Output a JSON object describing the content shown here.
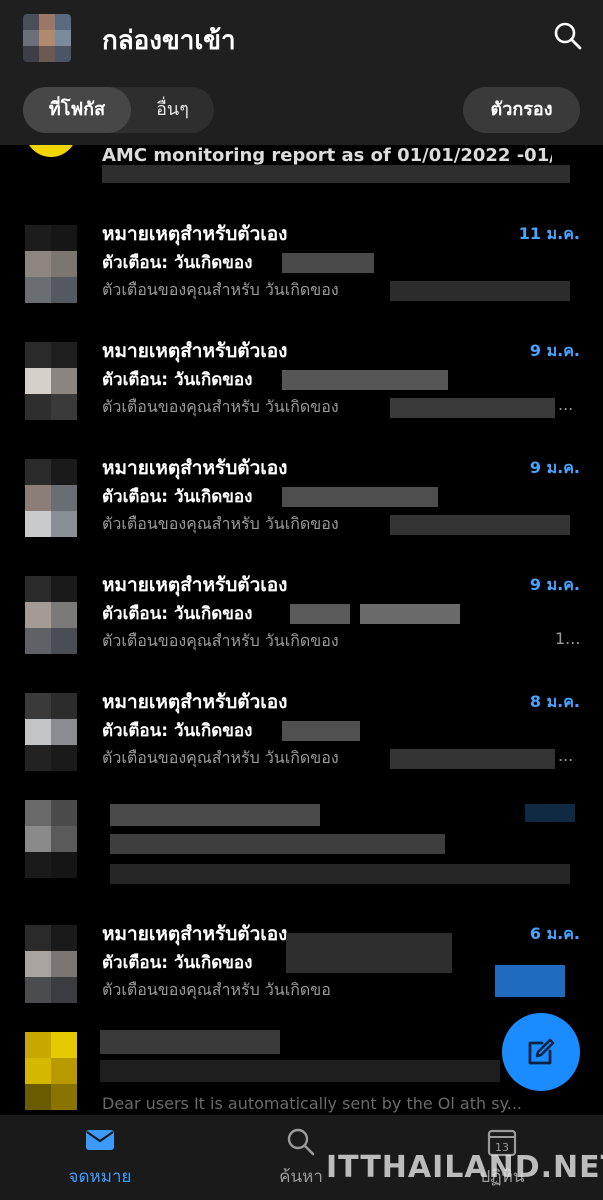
{
  "header": {
    "title": "กล่องขาเข้า",
    "tabs": [
      {
        "label": "ที่โฟกัส",
        "selected": true
      },
      {
        "label": "อื่นๆ",
        "selected": false
      }
    ],
    "filter_label": "ตัวกรอง",
    "search_icon": "search-icon"
  },
  "list": {
    "partial_subject": "AMC monitoring report as of 01/01/2022 -01/1...",
    "messages": [
      {
        "subject": "หมายเหตุสำหรับตัวเอง",
        "date": "11 ม.ค.",
        "sender": "ตัวเตือน: วันเกิดของ",
        "preview": "ตัวเตือนของคุณสำหรับ วันเกิดของ"
      },
      {
        "subject": "หมายเหตุสำหรับตัวเอง",
        "date": "9 ม.ค.",
        "sender": "ตัวเตือน: วันเกิดของ",
        "preview": "ตัวเตือนของคุณสำหรับ วันเกิดของ",
        "tail": "..."
      },
      {
        "subject": "หมายเหตุสำหรับตัวเอง",
        "date": "9 ม.ค.",
        "sender": "ตัวเตือน: วันเกิดของ",
        "preview": "ตัวเตือนของคุณสำหรับ วันเกิดของ"
      },
      {
        "subject": "หมายเหตุสำหรับตัวเอง",
        "date": "9 ม.ค.",
        "sender": "ตัวเตือน: วันเกิดของ",
        "preview": "ตัวเตือนของคุณสำหรับ วันเกิดของ",
        "tail": "1..."
      },
      {
        "subject": "หมายเหตุสำหรับตัวเอง",
        "date": "8 ม.ค.",
        "sender": "ตัวเตือน: วันเกิดของ",
        "preview": "ตัวเตือนของคุณสำหรับ วันเกิดของ",
        "tail": "..."
      },
      {
        "subject": "หมายเหตุสำหรับตัวเอง",
        "date": "6 ม.ค.",
        "sender": "ตัวเตือน: วันเกิดของ",
        "preview": "ตัวเตือนของคุณสำหรับ วันเกิดขอ"
      }
    ],
    "last_preview": "Dear users It is automatically sent by the Ol ath sy..."
  },
  "bottom_nav": {
    "items": [
      {
        "label": "จดหมาย",
        "icon": "mail-icon",
        "active": true
      },
      {
        "label": "ค้นหา",
        "icon": "search-icon",
        "active": false
      },
      {
        "label": "ปฏิทิน",
        "icon": "calendar-icon",
        "active": false,
        "calendar_day": "13"
      }
    ]
  },
  "watermark": "ITTHAILAND.NET",
  "colors": {
    "accent": "#1a8cff",
    "date": "#4aa3ff",
    "header_bg": "#1f1f1f",
    "background": "#000000"
  }
}
